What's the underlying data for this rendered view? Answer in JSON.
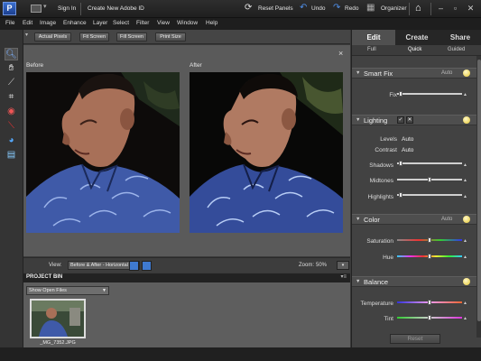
{
  "titlebar": {
    "sign_in": "Sign In",
    "create_id": "Create New Adobe ID",
    "reset_panels": "Reset Panels",
    "undo": "Undo",
    "redo": "Redo",
    "organizer": "Organizer",
    "logo_letter": "P"
  },
  "menu": [
    "File",
    "Edit",
    "Image",
    "Enhance",
    "Layer",
    "Select",
    "Filter",
    "View",
    "Window",
    "Help"
  ],
  "options": {
    "actual_pixels": "Actual Pixels",
    "fit_screen": "Fit Screen",
    "fill_screen": "Fill Screen",
    "print_size": "Print Size"
  },
  "compare": {
    "before": "Before",
    "after": "After",
    "close": "×"
  },
  "viewbar": {
    "view_label": "View:",
    "view_value": "Before & After - Horizontal",
    "zoom_label": "Zoom:",
    "zoom_value": "50%"
  },
  "bin": {
    "title": "PROJECT BIN",
    "show_select": "Show Open Files",
    "thumb_name": "_MG_7352.JPG"
  },
  "panel": {
    "tabs": [
      "Edit",
      "Create",
      "Share"
    ],
    "subtabs": [
      "Full",
      "Quick",
      "Guided"
    ],
    "smart_fix": {
      "title": "Smart Fix",
      "auto": "Auto",
      "fix": "Fix",
      "fix_level": 0.05
    },
    "lighting": {
      "title": "Lighting",
      "levels_label": "Levels",
      "levels_btn": "Auto",
      "contrast_label": "Contrast",
      "contrast_btn": "Auto",
      "shadows_label": "Shadows",
      "shadows_level": 0.06,
      "midtones_label": "Midtones",
      "midtones_level": 0.5,
      "highlights_label": "Highlights",
      "highlights_level": 0.06
    },
    "color": {
      "title": "Color",
      "auto": "Auto",
      "saturation_label": "Saturation",
      "saturation_level": 0.5,
      "hue_label": "Hue",
      "hue_level": 0.5
    },
    "balance": {
      "title": "Balance",
      "temperature_label": "Temperature",
      "temperature_level": 0.5,
      "tint_label": "Tint",
      "tint_level": 0.5
    },
    "reset": "Reset"
  },
  "colors": {
    "accent": "#3f7ad0",
    "panel_bg": "#424242",
    "photo_shirt": "#3f5aa8"
  }
}
